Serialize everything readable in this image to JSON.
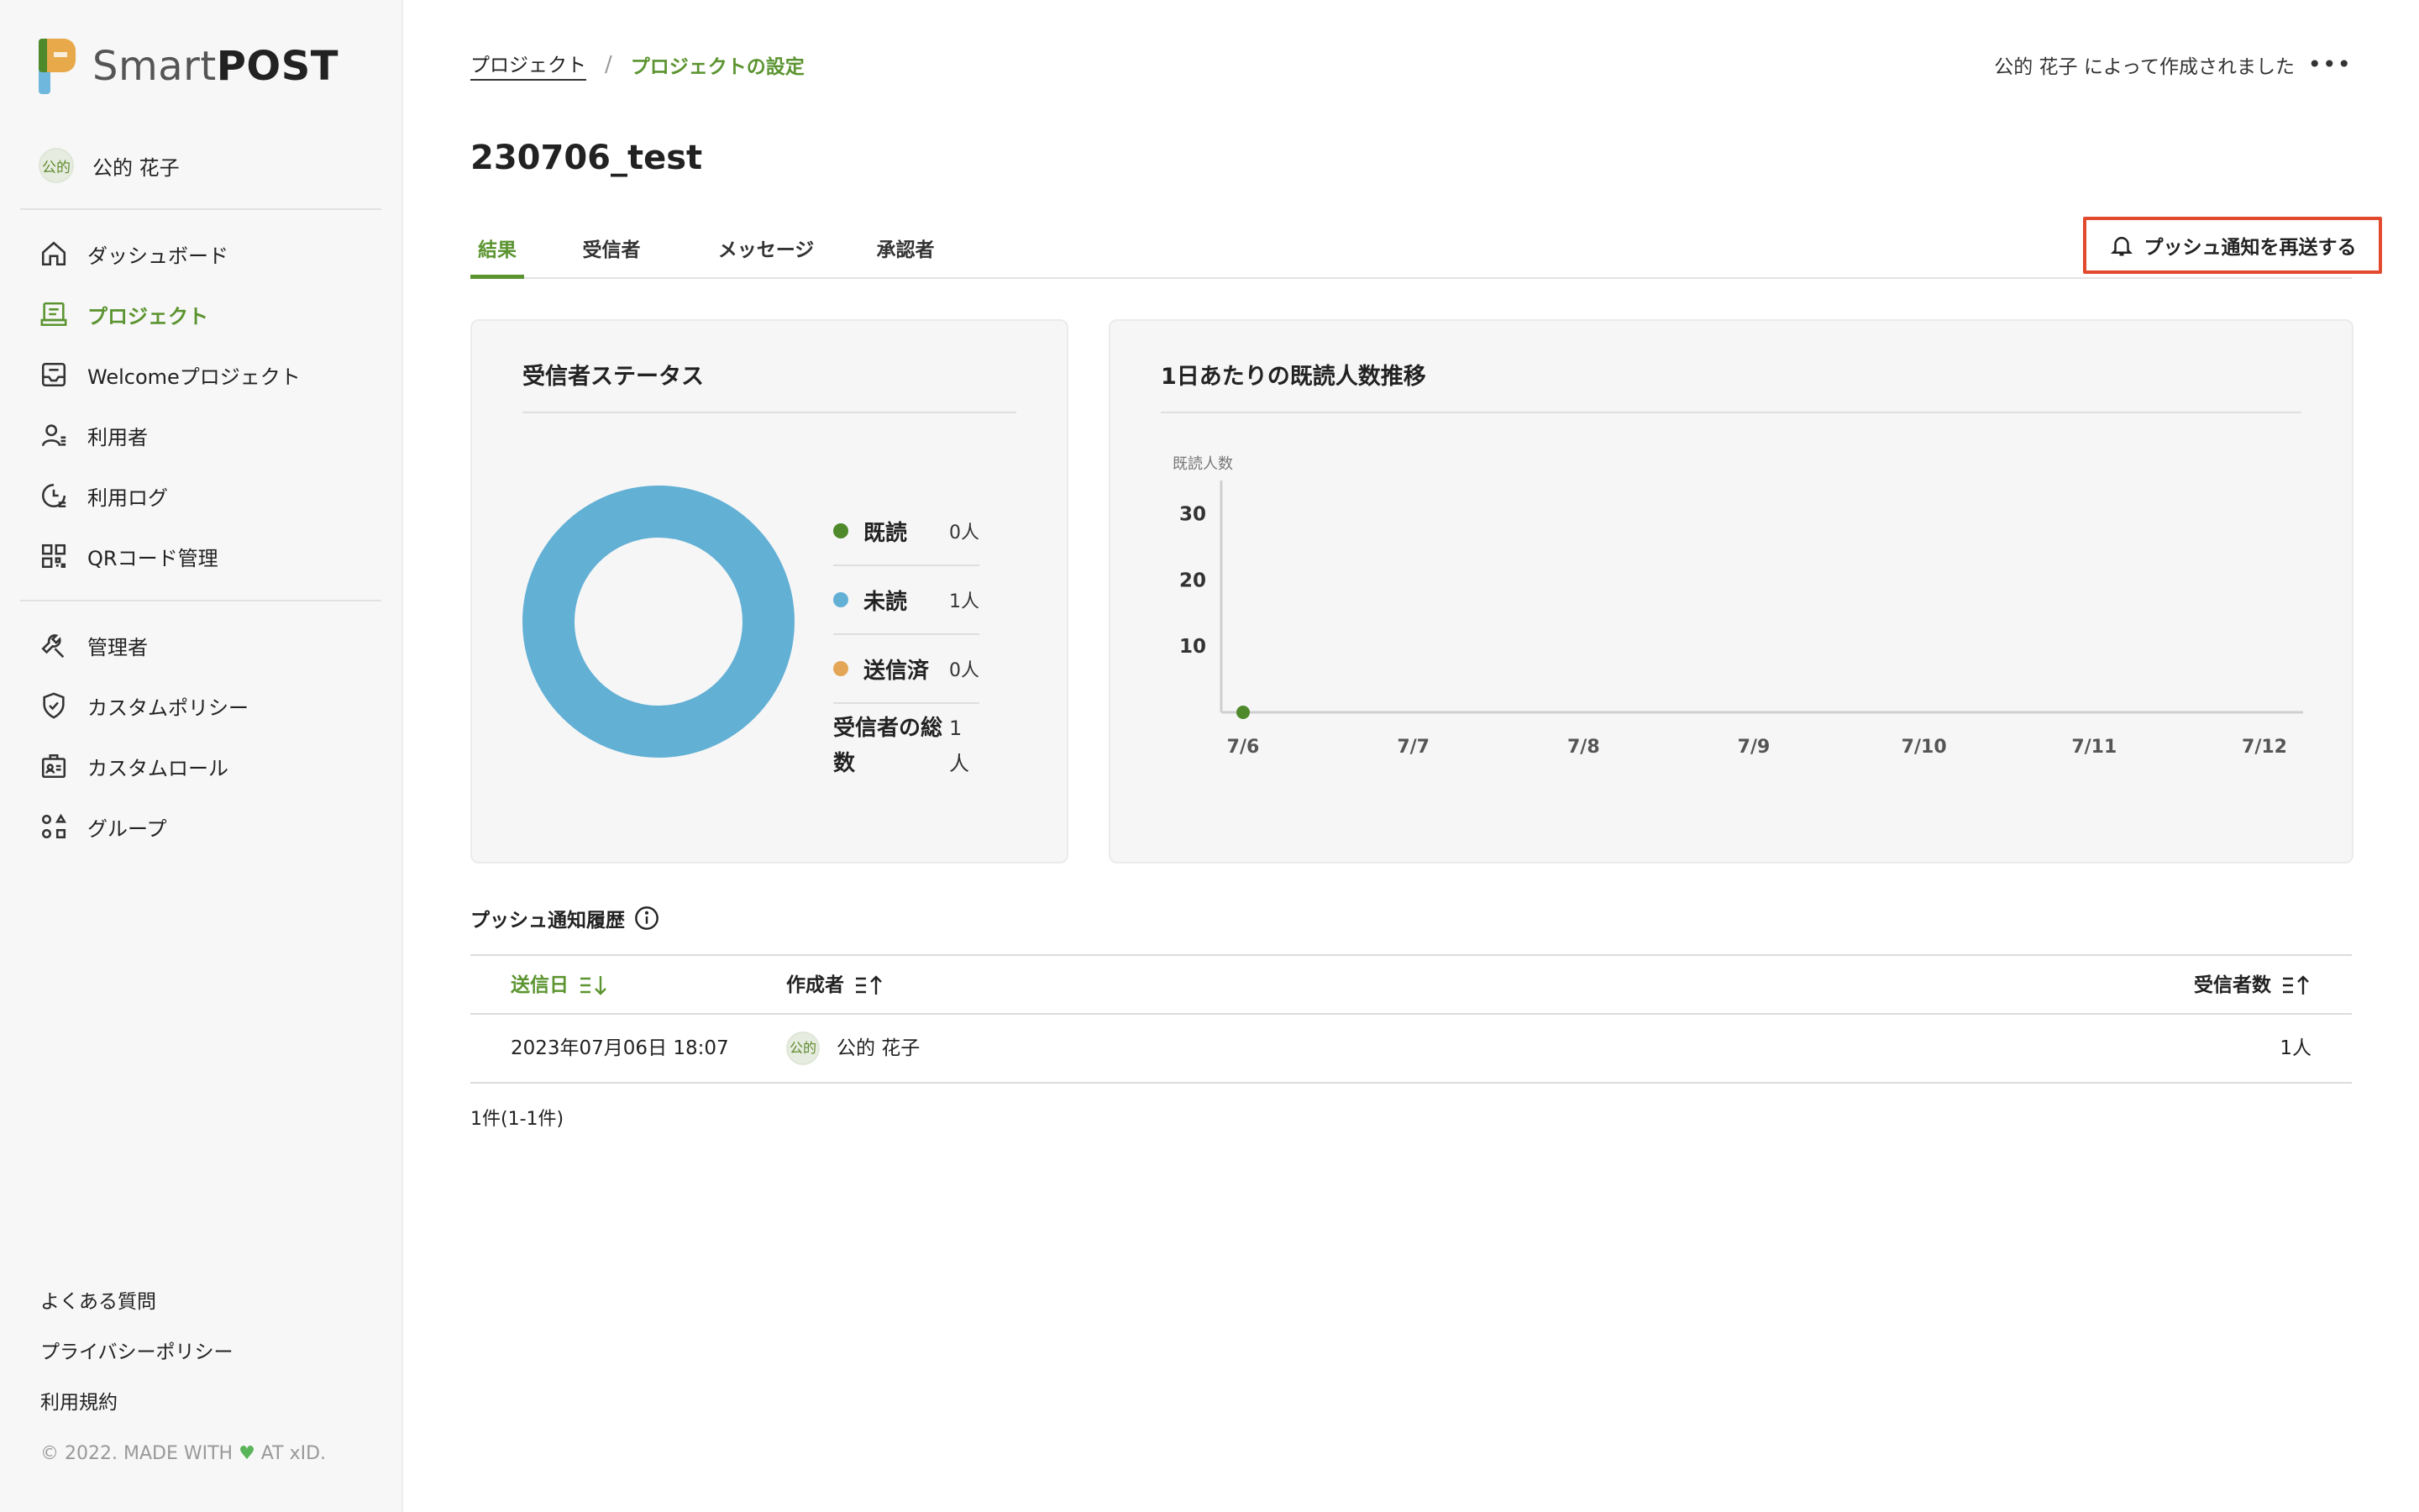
{
  "app": {
    "logo_light": "Smart",
    "logo_bold": "POST"
  },
  "user": {
    "avatar_text": "公的",
    "name": "公的 花子"
  },
  "sidebar": {
    "items": [
      {
        "label": "ダッシュボード",
        "icon": "home-icon"
      },
      {
        "label": "プロジェクト",
        "icon": "project-icon",
        "active": true
      },
      {
        "label": "Welcomeプロジェクト",
        "icon": "welcome-project-icon"
      },
      {
        "label": "利用者",
        "icon": "users-icon"
      },
      {
        "label": "利用ログ",
        "icon": "log-icon"
      },
      {
        "label": "QRコード管理",
        "icon": "qr-code-icon"
      }
    ],
    "admin_items": [
      {
        "label": "管理者",
        "icon": "wrench-icon"
      },
      {
        "label": "カスタムポリシー",
        "icon": "shield-check-icon"
      },
      {
        "label": "カスタムロール",
        "icon": "role-icon"
      },
      {
        "label": "グループ",
        "icon": "group-icon"
      }
    ],
    "footer_links": [
      "よくある質問",
      "プライバシーポリシー",
      "利用規約"
    ],
    "copyright_before": "© 2022. MADE WITH",
    "copyright_after": "AT xID."
  },
  "header": {
    "breadcrumb": [
      "プロジェクト",
      "プロジェクトの設定"
    ],
    "breadcrumb_separator": "/",
    "created_by": "公的 花子 によって作成されました",
    "more": "•••"
  },
  "project": {
    "title": "230706_test"
  },
  "tabs": [
    {
      "label": "結果",
      "active": true
    },
    {
      "label": "受信者"
    },
    {
      "label": "メッセージ"
    },
    {
      "label": "承認者"
    }
  ],
  "push_button": {
    "label": "プッシュ通知を再送する"
  },
  "status_card": {
    "title": "受信者ステータス",
    "legend": [
      {
        "label": "既読",
        "value": "0人",
        "color": "#4e8a2b"
      },
      {
        "label": "未読",
        "value": "1人",
        "color": "#63b0d5"
      },
      {
        "label": "送信済",
        "value": "0人",
        "color": "#e3a656"
      }
    ],
    "total_label": "受信者の総数",
    "total_value": "1人"
  },
  "trend_card": {
    "title": "1日あたりの既読人数推移"
  },
  "chart_data": [
    {
      "type": "pie",
      "donut": true,
      "labels": [
        "既読",
        "未読",
        "送信済"
      ],
      "values": [
        0,
        1,
        0
      ],
      "colors": [
        "#4e8a2b",
        "#63b0d5",
        "#e3a656"
      ]
    },
    {
      "type": "line",
      "ylabel": "既読人数",
      "categories": [
        "7/6",
        "7/7",
        "7/8",
        "7/9",
        "7/10",
        "7/11",
        "7/12"
      ],
      "series": [
        {
          "values": [
            0,
            null,
            null,
            null,
            null,
            null,
            null
          ]
        }
      ],
      "yticks": [
        10,
        20,
        30
      ],
      "ylim": [
        0,
        35
      ],
      "grid": false,
      "color": "#4e8a2b"
    }
  ],
  "history": {
    "title": "プッシュ通知履歴",
    "columns": {
      "date": "送信日",
      "author": "作成者",
      "recipients": "受信者数"
    },
    "rows": [
      {
        "date": "2023年07月06日 18:07",
        "author_avatar": "公的",
        "author": "公的 花子",
        "recipients": "1人"
      }
    ],
    "count_text": "1件(1-1件)"
  },
  "colors": {
    "accent": "#5b9430",
    "highlight_border": "#e24a2e"
  }
}
